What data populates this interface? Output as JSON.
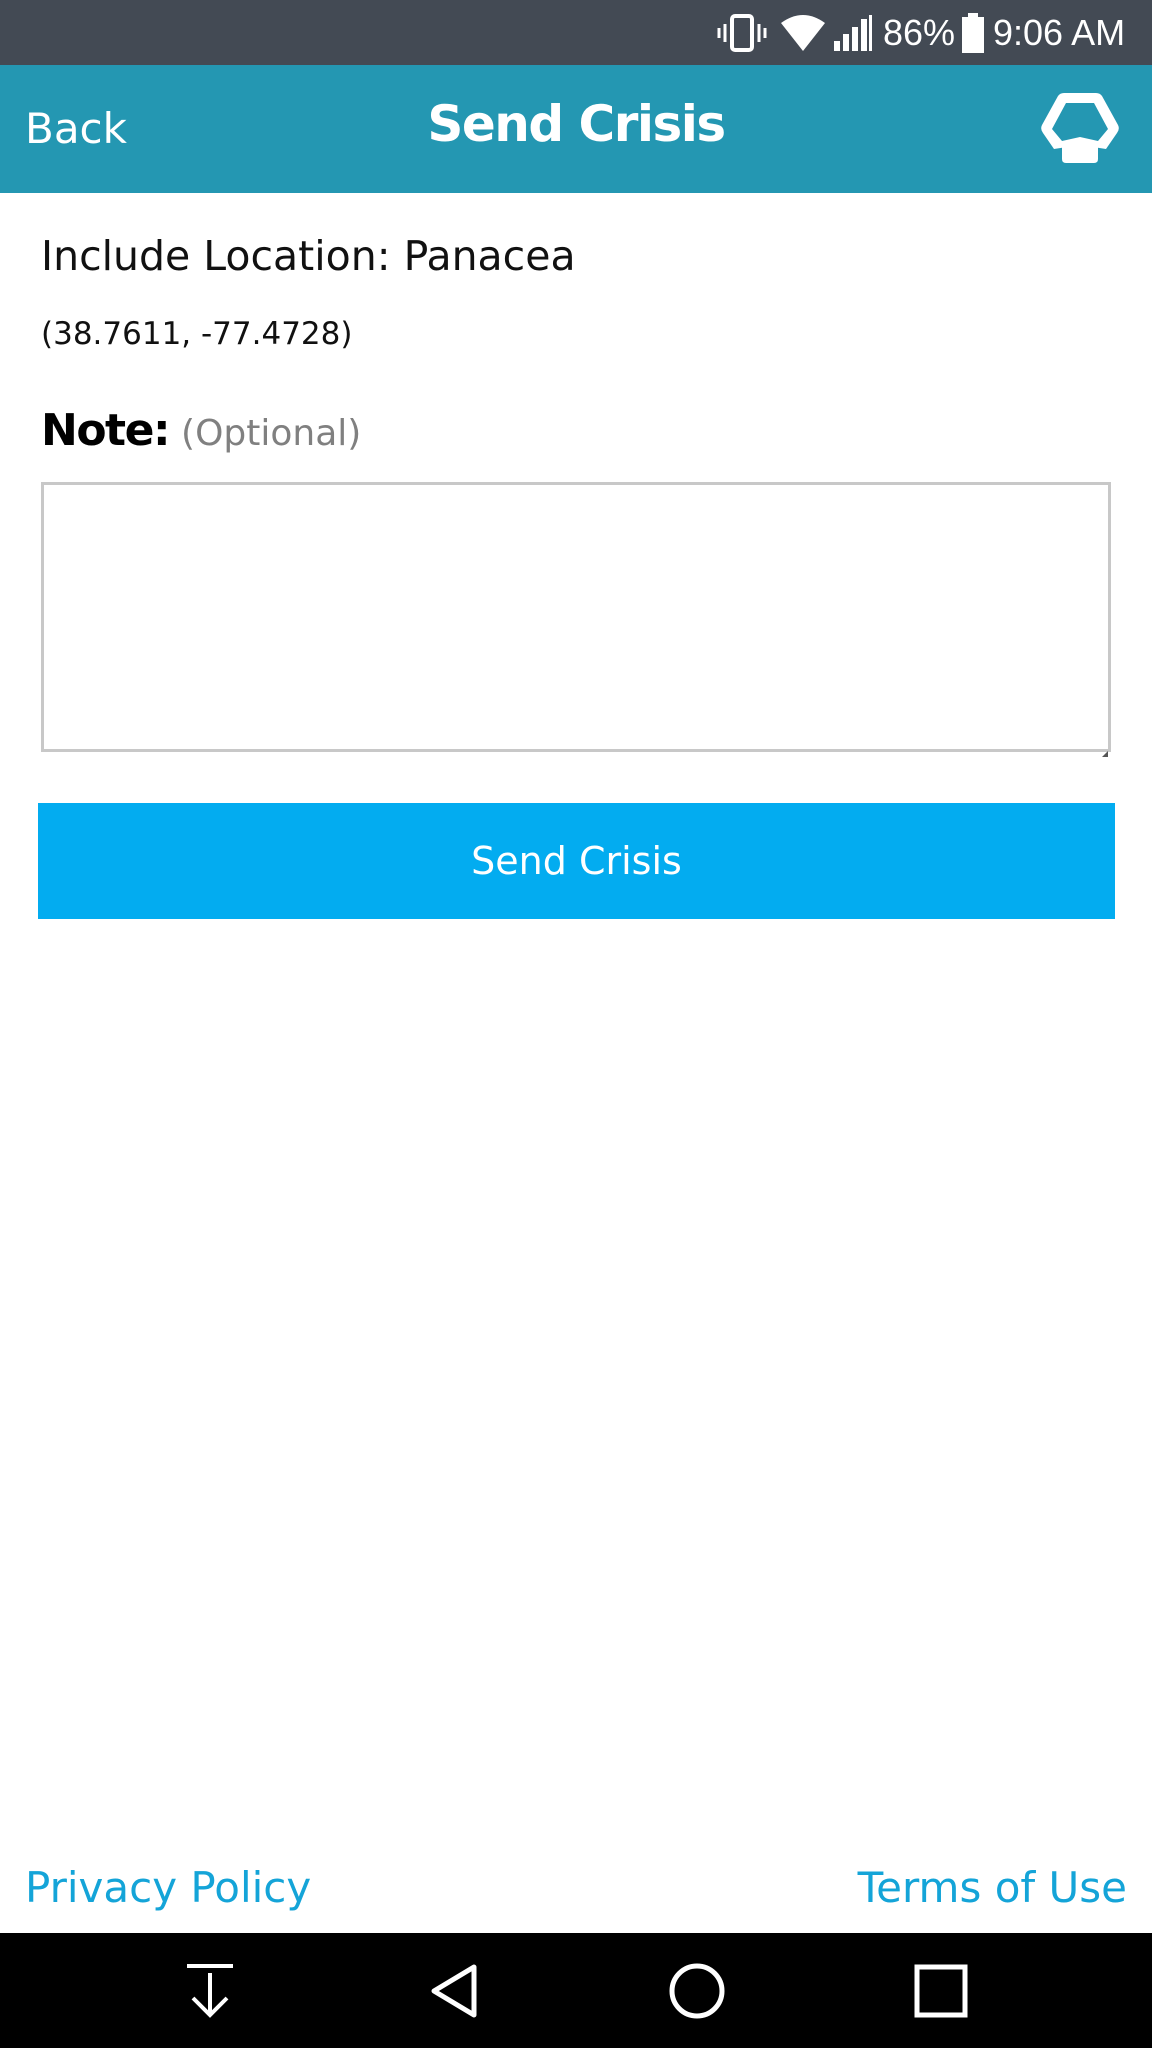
{
  "status_bar": {
    "battery_percent": "86%",
    "time": "9:06 AM",
    "icons": [
      "vibrate-icon",
      "wifi-icon",
      "signal-icon",
      "battery-icon"
    ]
  },
  "header": {
    "back_label": "Back",
    "title": "Send Crisis",
    "logo_icon": "app-logo-icon",
    "background_color": "#2497b2"
  },
  "location": {
    "label": "Include Location:",
    "name": "Panacea",
    "coordinates": "(38.7611, -77.4728)"
  },
  "note": {
    "label": "Note",
    "colon": ":",
    "optional_hint": "(Optional)",
    "value": "",
    "placeholder": ""
  },
  "send_button": {
    "label": "Send Crisis",
    "color": "#03acf0"
  },
  "footer": {
    "privacy_label": "Privacy Policy",
    "terms_label": "Terms of Use",
    "link_color": "#14a4d8"
  },
  "nav_bar": {
    "buttons": [
      "notification-drawer-icon",
      "back-triangle-icon",
      "home-circle-icon",
      "recents-square-icon"
    ]
  }
}
